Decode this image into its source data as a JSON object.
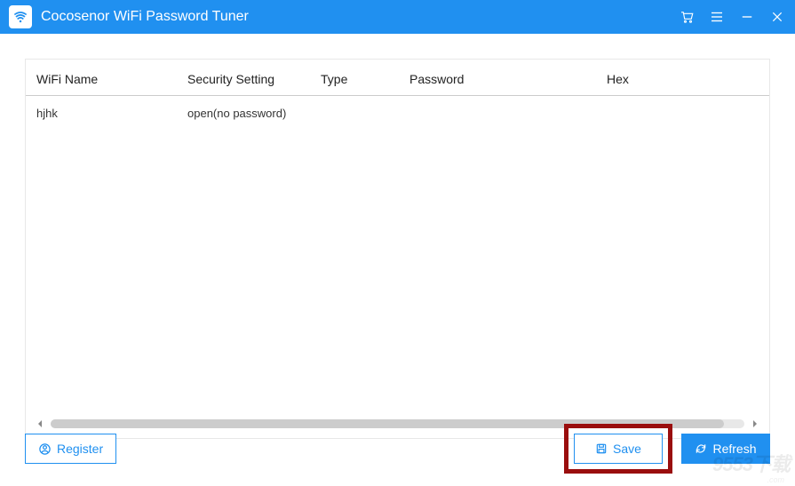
{
  "titlebar": {
    "title": "Cocosenor WiFi Password Tuner"
  },
  "table": {
    "headers": {
      "name": "WiFi Name",
      "security": "Security Setting",
      "type": "Type",
      "password": "Password",
      "hex": "Hex"
    },
    "rows": [
      {
        "name": "hjhk",
        "security": "open(no password)",
        "type": "",
        "password": "",
        "hex": ""
      }
    ]
  },
  "footer": {
    "register": "Register",
    "save": "Save",
    "refresh": "Refresh"
  },
  "watermark": {
    "main": "9553下载",
    "sub": ".com"
  }
}
